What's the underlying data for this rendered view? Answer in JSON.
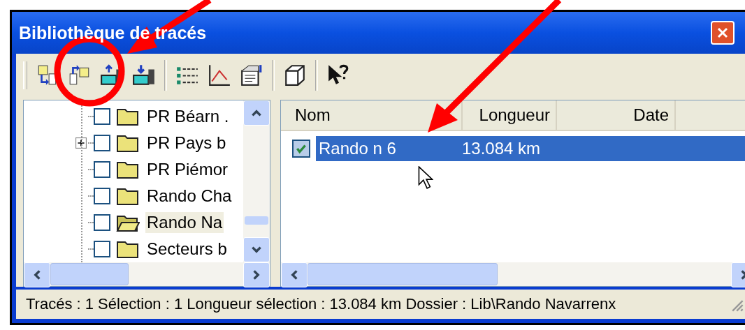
{
  "window": {
    "title": "Bibliothèque de tracés"
  },
  "tree": {
    "items": [
      {
        "label": "PR Béarn .",
        "checked": false,
        "selected": false,
        "expandable": false
      },
      {
        "label": "PR Pays b",
        "checked": false,
        "selected": false,
        "expandable": true
      },
      {
        "label": "PR Piémor",
        "checked": false,
        "selected": false,
        "expandable": false
      },
      {
        "label": "Rando Cha",
        "checked": false,
        "selected": false,
        "expandable": false
      },
      {
        "label": "Rando Na",
        "checked": false,
        "selected": true,
        "expandable": false
      },
      {
        "label": "Secteurs b",
        "checked": false,
        "selected": false,
        "expandable": false
      }
    ]
  },
  "table": {
    "columns": [
      "Nom",
      "Longueur",
      "Date"
    ],
    "rows": [
      {
        "name": "Rando n 6",
        "length": "13.084 km",
        "checked": true,
        "selected": true
      }
    ]
  },
  "status_bar": "Tracés : 1 Sélection : 1 Longueur sélection : 13.084 km Dossier : Lib\\Rando Navarrenx"
}
